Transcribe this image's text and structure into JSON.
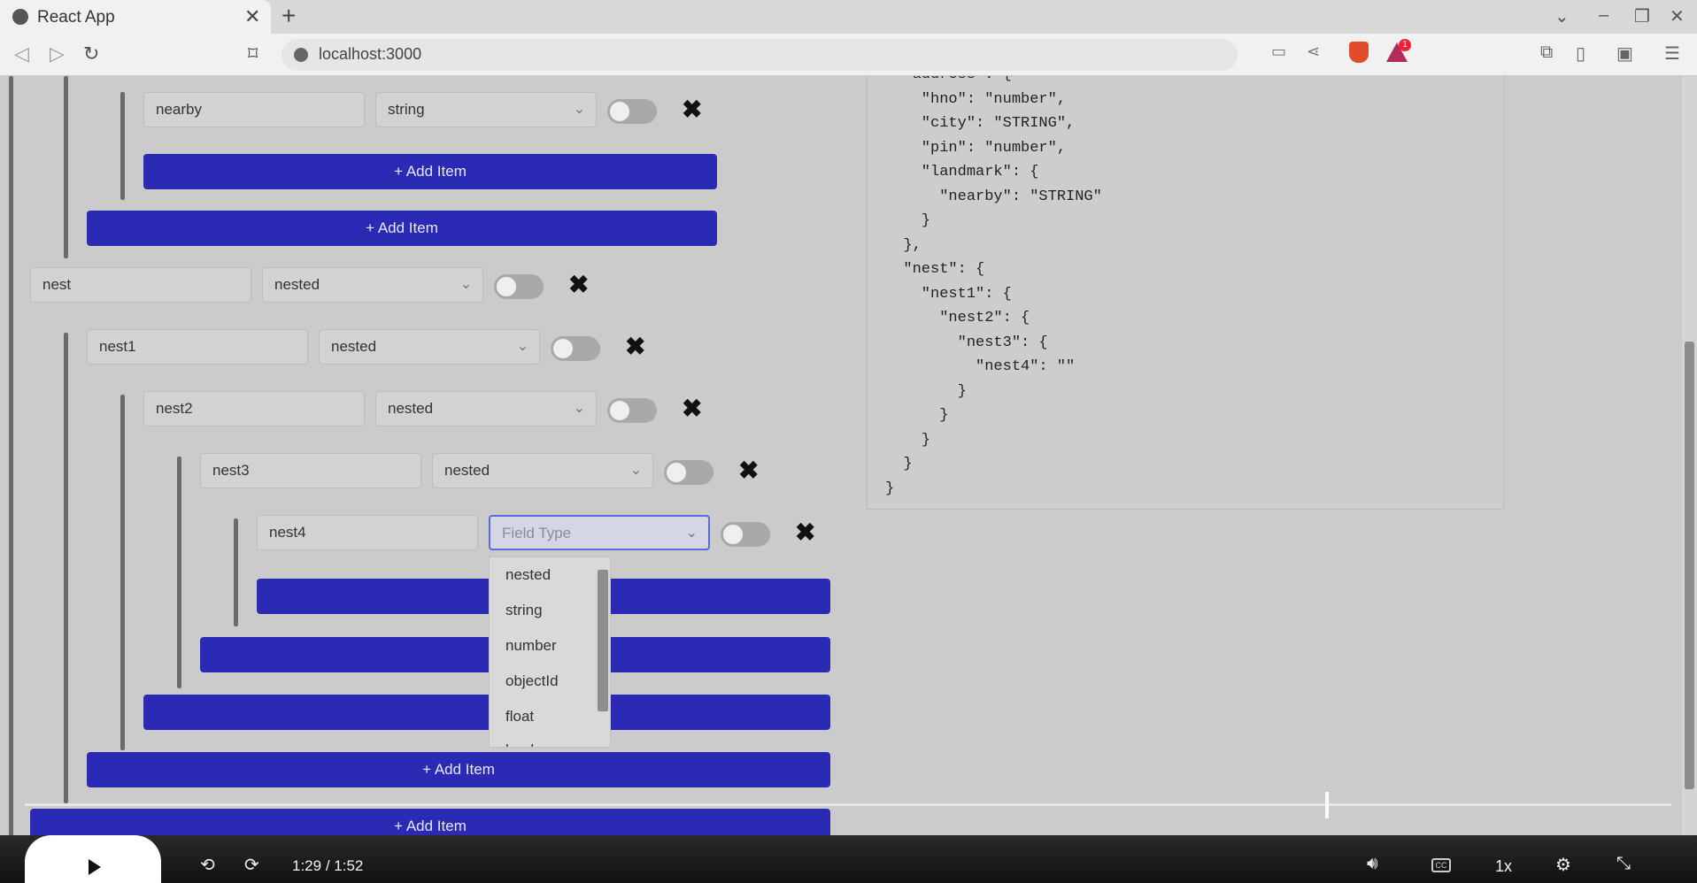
{
  "browser": {
    "tab_title": "React App",
    "tab_close": "✕",
    "new_tab": "+",
    "url": "localhost:3000",
    "rewards_badge": "1"
  },
  "form": {
    "add_item_label": "+ Add Item",
    "rows": [
      {
        "name": "nearby",
        "type": "string"
      },
      {
        "name": "nest",
        "type": "nested"
      },
      {
        "name": "nest1",
        "type": "nested"
      },
      {
        "name": "nest2",
        "type": "nested"
      },
      {
        "name": "nest3",
        "type": "nested"
      },
      {
        "name": "nest4",
        "type": ""
      }
    ],
    "field_type_placeholder": "Field Type",
    "delete_glyph": "✖"
  },
  "dropdown": {
    "options": [
      "nested",
      "string",
      "number",
      "objectId",
      "float",
      "boolean"
    ]
  },
  "json_preview": {
    "lines": [
      "  \"address\": {",
      "    \"hno\": \"number\",",
      "    \"city\": \"STRING\",",
      "    \"pin\": \"number\",",
      "    \"landmark\": {",
      "      \"nearby\": \"STRING\"",
      "    }",
      "  },",
      "  \"nest\": {",
      "    \"nest1\": {",
      "      \"nest2\": {",
      "        \"nest3\": {",
      "          \"nest4\": \"\"",
      "        }",
      "      }",
      "    }",
      "  }",
      "}"
    ]
  },
  "video": {
    "current_time": "1:29",
    "duration": "/ 1:52",
    "speed": "1x",
    "progress_fraction": 0.79,
    "cc_label": "CC"
  }
}
